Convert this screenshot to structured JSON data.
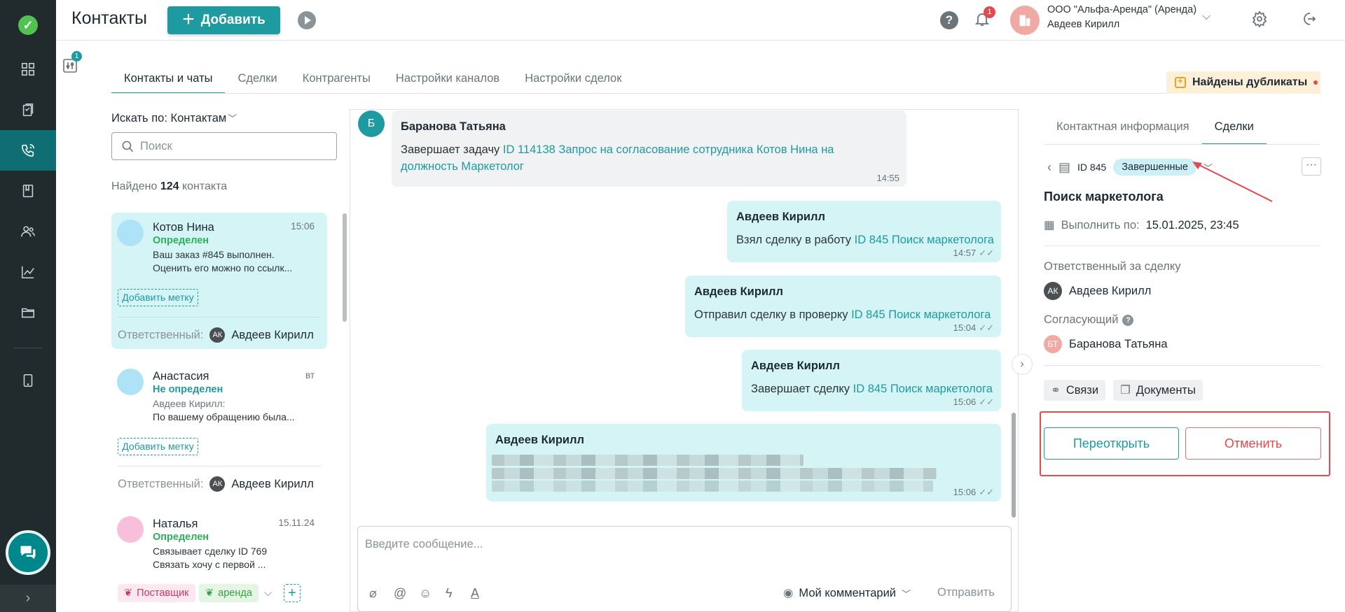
{
  "topbar": {
    "title": "Контакты",
    "add_label": "Добавить",
    "notifications_count": "1",
    "org_name": "ООО \"Альфа-Аренда\" (Аренда)",
    "user_name": "Авдеев Кирилл"
  },
  "filter_badge": "1",
  "tabs": [
    {
      "label": "Контакты и чаты",
      "active": true
    },
    {
      "label": "Сделки"
    },
    {
      "label": "Контрагенты"
    },
    {
      "label": "Настройки каналов"
    },
    {
      "label": "Настройки сделок"
    }
  ],
  "duplicates_label": "Найдены дубликаты",
  "search": {
    "by_label": "Искать по: Контактам",
    "placeholder": "Поиск"
  },
  "found": {
    "prefix": "Найдено",
    "count": "124",
    "suffix": "контакта"
  },
  "contacts": [
    {
      "name": "Котов Нина",
      "time": "15:06",
      "status": "Определен",
      "message_line1": "Ваш заказ #845 выполнен.",
      "message_line2": "Оценить его можно по ссылк...",
      "tag_label": "Добавить метку",
      "responsible_label": "Ответственный:",
      "responsible_initials": "АК",
      "responsible_name": "Авдеев Кирилл"
    },
    {
      "name": "Анастасия",
      "time": "вт",
      "status": "Не определен",
      "message_sender": "Авдеев Кирилл:",
      "message_line1": "По вашему обращению была...",
      "tag_label": "Добавить метку",
      "responsible_label": "Ответственный:",
      "responsible_initials": "АК",
      "responsible_name": "Авдеев Кирилл"
    },
    {
      "name": "Наталья",
      "time": "15.11.24",
      "status": "Определен",
      "message_line1": "Связывает сделку ID 769",
      "message_line2": "Связать хочу с первой ...",
      "tags": [
        "Поставщик",
        "аренда"
      ]
    }
  ],
  "chat": {
    "messages": [
      {
        "author_initial": "Б",
        "author": "Баранова Татьяна",
        "text": "Завершает задачу",
        "link": "ID 114138 Запрос на согласование сотрудника Котов Нина на",
        "link2": "должность Маркетолог",
        "time": "14:55"
      },
      {
        "author": "Авдеев Кирилл",
        "text": "Взял сделку в работу",
        "link": "ID 845 Поиск маркетолога",
        "time": "14:57"
      },
      {
        "author": "Авдеев Кирилл",
        "text": "Отправил сделку в проверку",
        "link": "ID 845 Поиск маркетолога",
        "time": "15:04"
      },
      {
        "author": "Авдеев Кирилл",
        "text": "Завершает сделку",
        "link": "ID 845 Поиск маркетолога",
        "time": "15:06"
      },
      {
        "author": "Авдеев Кирилл",
        "text_blurred": true,
        "time": "15:06"
      }
    ],
    "input_placeholder": "Введите сообщение...",
    "comment_label": "Мой комментарий",
    "send_label": "Отправить"
  },
  "right_panel": {
    "tabs": [
      {
        "label": "Контактная информация"
      },
      {
        "label": "Сделки",
        "active": true
      }
    ],
    "deal_id": "ID 845",
    "deal_status": "Завершенные",
    "deal_title": "Поиск маркетолога",
    "due_label": "Выполнить по:",
    "due_value": "15.01.2025, 23:45",
    "responsible_label": "Ответственный за сделку",
    "responsible_initials": "АК",
    "responsible_name": "Авдеев Кирилл",
    "approver_label": "Согласующий",
    "approver_initials": "БТ",
    "approver_name": "Баранова Татьяна",
    "links_label": "Связи",
    "documents_label": "Документы",
    "reopen_label": "Переоткрыть",
    "cancel_label": "Отменить"
  },
  "colors": {
    "accent": "#1e9aa1",
    "sidebar": "#212b2e",
    "danger": "#e5484d",
    "bubble": "#d4f4f6"
  }
}
